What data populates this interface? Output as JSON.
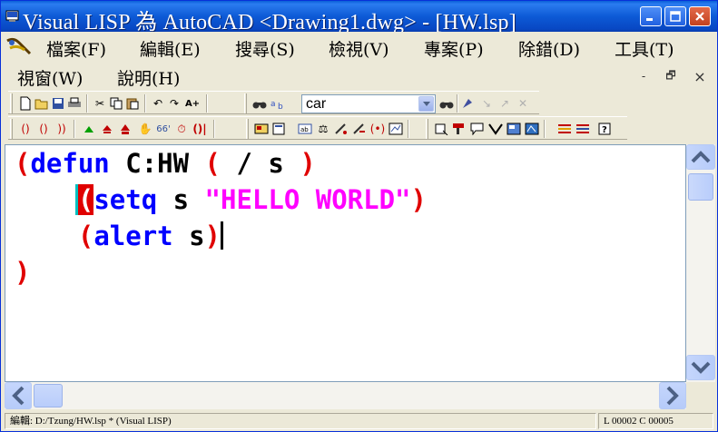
{
  "window": {
    "title": "Visual LISP 為 AutoCAD <Drawing1.dwg> - [HW.lsp]",
    "controls": {
      "minimize": "minimize",
      "maximize": "maximize",
      "close": "close"
    }
  },
  "menubar": {
    "items": [
      {
        "label": "檔案(F)"
      },
      {
        "label": "編輯(E)"
      },
      {
        "label": "搜尋(S)"
      },
      {
        "label": "檢視(V)"
      },
      {
        "label": "專案(P)"
      },
      {
        "label": "除錯(D)"
      },
      {
        "label": "工具(T)"
      },
      {
        "label": "視窗(W)"
      },
      {
        "label": "說明(H)"
      }
    ],
    "mdi": {
      "minimize": "-",
      "restore": "🗗",
      "close": "×"
    }
  },
  "toolbar": {
    "search_value": "car"
  },
  "editor": {
    "lines": [
      [
        {
          "t": "(",
          "c": "paren"
        },
        {
          "t": "defun",
          "c": "kw"
        },
        {
          "t": " C:HW ",
          "c": "sym"
        },
        {
          "t": "(",
          "c": "paren"
        },
        {
          "t": " / s ",
          "c": "sym"
        },
        {
          "t": ")",
          "c": "paren"
        }
      ],
      [
        {
          "t": "    ",
          "c": "sym"
        },
        {
          "t": "(",
          "c": "paren",
          "hl": true
        },
        {
          "t": "setq",
          "c": "kw"
        },
        {
          "t": " s ",
          "c": "sym"
        },
        {
          "t": "\"HELLO WORLD\"",
          "c": "str"
        },
        {
          "t": ")",
          "c": "paren"
        }
      ],
      [
        {
          "t": "    ",
          "c": "sym"
        },
        {
          "t": "(",
          "c": "paren"
        },
        {
          "t": "alert",
          "c": "kw"
        },
        {
          "t": " s",
          "c": "sym"
        },
        {
          "t": ")",
          "c": "paren"
        },
        {
          "caret": true
        }
      ],
      [
        {
          "t": ")",
          "c": "paren"
        }
      ]
    ]
  },
  "statusbar": {
    "left": "編輯:  D:/Tzung/HW.lsp *  (Visual LISP)",
    "right": "L 00002  C 00005"
  },
  "colors": {
    "titlebar": "#0d5ad6",
    "paren": "#e00000",
    "keyword": "#0000ff",
    "string": "#ff00ff"
  }
}
